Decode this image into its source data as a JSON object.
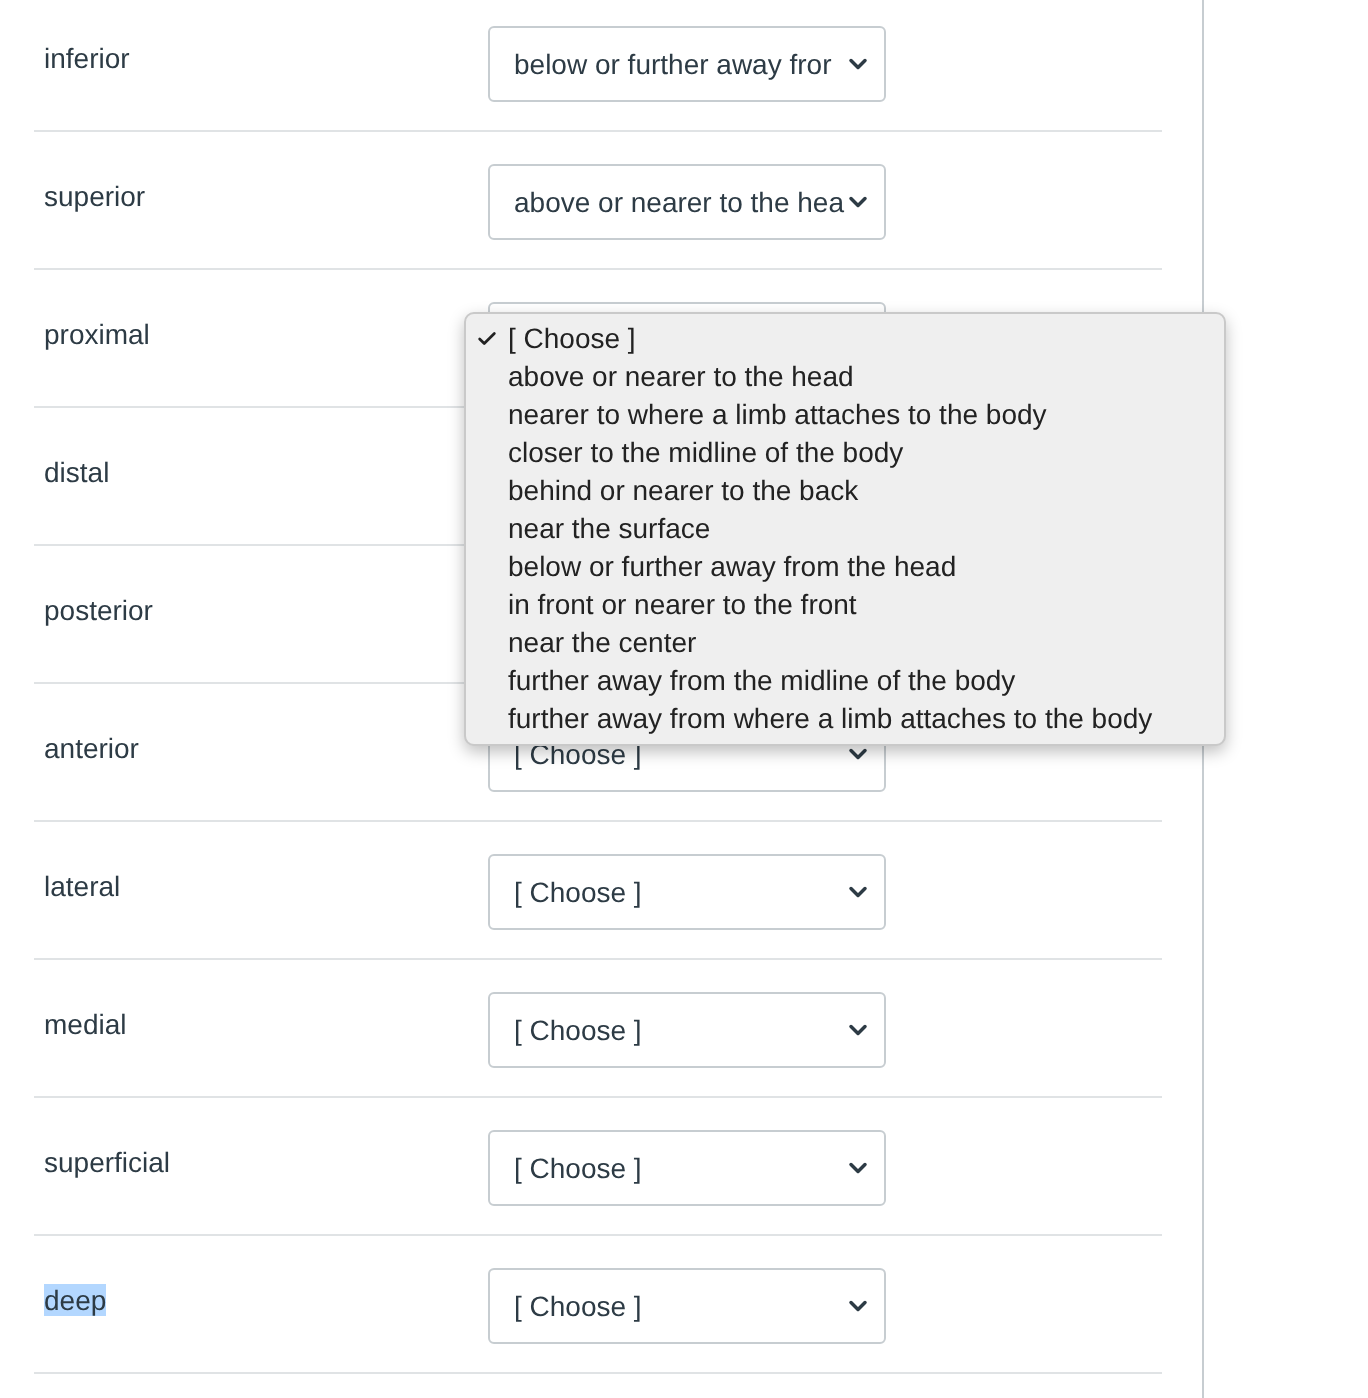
{
  "rows": [
    {
      "label": "inferior",
      "value": "below or further away fror"
    },
    {
      "label": "superior",
      "value": "above or nearer to the hea"
    },
    {
      "label": "proximal",
      "open": true,
      "options": [
        {
          "label": "[ Choose ]",
          "selected": true
        },
        {
          "label": "above or nearer to the head",
          "selected": false
        },
        {
          "label": "nearer to where a limb attaches to the body",
          "selected": false
        },
        {
          "label": "closer to the midline of the body",
          "selected": false
        },
        {
          "label": "behind or nearer to the back",
          "selected": false
        },
        {
          "label": "near the surface",
          "selected": false
        },
        {
          "label": "below or further away from the head",
          "selected": false
        },
        {
          "label": "in front or nearer to the front",
          "selected": false
        },
        {
          "label": "near the center",
          "selected": false
        },
        {
          "label": "further away from the midline of the body",
          "selected": false
        },
        {
          "label": "further away from where a limb attaches to the body",
          "selected": false
        }
      ]
    },
    {
      "label": "distal"
    },
    {
      "label": "posterior"
    },
    {
      "label": "anterior",
      "value": "[ Choose ]"
    },
    {
      "label": "lateral",
      "value": "[ Choose ]"
    },
    {
      "label": "medial",
      "value": "[ Choose ]"
    },
    {
      "label": "superficial",
      "value": "[ Choose ]"
    },
    {
      "label": "deep",
      "value": "[ Choose ]",
      "highlighted": true
    }
  ]
}
